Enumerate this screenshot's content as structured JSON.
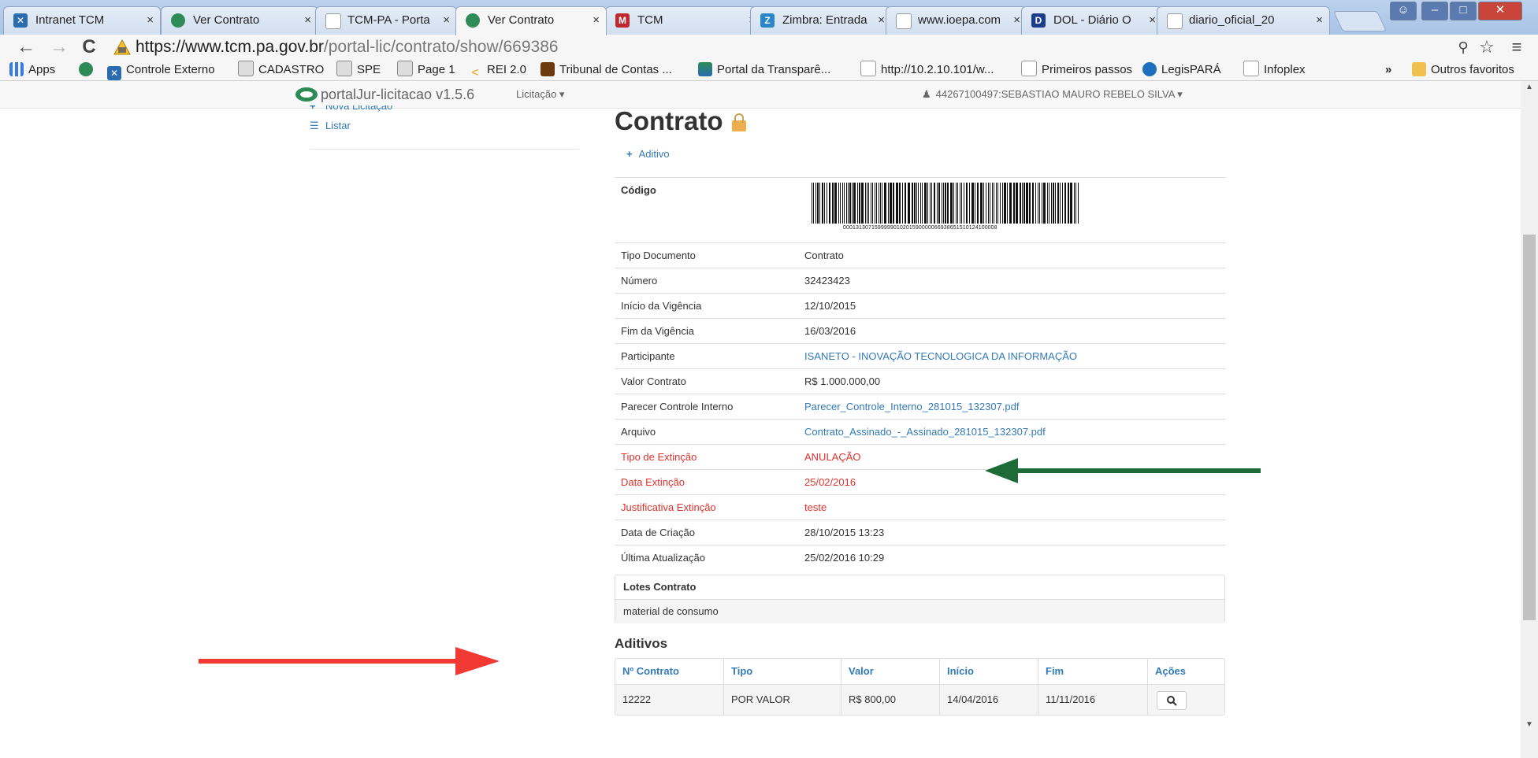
{
  "browser": {
    "tabs": [
      {
        "title": "Intranet TCM",
        "icon": "intranet-icon"
      },
      {
        "title": "Ver Contrato",
        "icon": "tcm-logo-icon"
      },
      {
        "title": "TCM-PA - Porta",
        "icon": "page-icon"
      },
      {
        "title": "Ver Contrato",
        "icon": "tcm-logo-icon"
      },
      {
        "title": "TCM",
        "icon": "tcm-icon"
      },
      {
        "title": "Zimbra: Entrada",
        "icon": "zimbra-icon"
      },
      {
        "title": "www.ioepa.com",
        "icon": "page-icon"
      },
      {
        "title": "DOL - Diário O",
        "icon": "dol-icon"
      },
      {
        "title": "diario_oficial_20",
        "icon": "page-icon"
      }
    ],
    "tab_close": "×",
    "url_host": "https://www.tcm.pa.gov.br",
    "url_path": "/portal-lic/contrato/show/669386",
    "bookmarks": [
      {
        "label": "Apps",
        "icon": "apps-icon"
      },
      {
        "label": "",
        "icon": "tcm-logo-icon"
      },
      {
        "label": "Controle Externo",
        "icon": "intranet-icon"
      },
      {
        "label": "CADASTRO",
        "icon": "image-icon"
      },
      {
        "label": "SPE",
        "icon": "image-icon"
      },
      {
        "label": "Page 1",
        "icon": "image-icon"
      },
      {
        "label": "REI 2.0",
        "icon": "rei-icon"
      },
      {
        "label": "Tribunal de Contas ...",
        "icon": "tribunal-icon"
      },
      {
        "label": "Portal da Transparê...",
        "icon": "flag-icon"
      },
      {
        "label": "http://10.2.10.101/w...",
        "icon": "page-icon"
      },
      {
        "label": "Primeiros passos",
        "icon": "page-icon"
      },
      {
        "label": "LegisPARÁ",
        "icon": "legis-icon"
      },
      {
        "label": "Infoplex",
        "icon": "page-icon"
      }
    ],
    "bookmarks_overflow": "»",
    "other_bookmarks": "Outros favoritos"
  },
  "app": {
    "brand": "portalJur-licitacao",
    "version": "v1.5.6",
    "menu_label": "Licitação ▾",
    "user_label": "44267100497:SEBASTIAO MAURO REBELO SILVA ▾"
  },
  "sidebar": {
    "items": [
      {
        "label": "Nova Licitação",
        "icon": "plus-icon"
      },
      {
        "label": "Listar",
        "icon": "list-icon"
      }
    ]
  },
  "page": {
    "title": "Contrato",
    "add_link": "Aditivo",
    "code_label": "Código",
    "barcode_number": "0001313071599999010201590000066938651510124100008",
    "rows": [
      {
        "key": "Tipo Documento",
        "value": "Contrato"
      },
      {
        "key": "Número",
        "value": "32423423"
      },
      {
        "key": "Início da Vigência",
        "value": "12/10/2015"
      },
      {
        "key": "Fim da Vigência",
        "value": "16/03/2016"
      },
      {
        "key": "Participante",
        "value": "ISANETO - INOVAÇÃO TECNOLOGICA DA INFORMAÇÃO"
      },
      {
        "key": "Valor Contrato",
        "value": "R$ 1.000.000,00"
      },
      {
        "key": "Parecer Controle Interno",
        "value": "Parecer_Controle_Interno_281015_132307.pdf"
      },
      {
        "key": "Arquivo",
        "value": "Contrato_Assinado_-_Assinado_281015_132307.pdf"
      },
      {
        "key": "Tipo de Extinção",
        "value": "ANULAÇÃO"
      },
      {
        "key": "Data Extinção",
        "value": "25/02/2016"
      },
      {
        "key": "Justificativa Extinção",
        "value": "teste"
      },
      {
        "key": "Data de Criação",
        "value": "28/10/2015 13:23"
      },
      {
        "key": "Última Atualização",
        "value": "25/02/2016 10:29"
      }
    ],
    "lotes": {
      "heading": "Lotes Contrato",
      "item": "material de consumo"
    },
    "aditivos": {
      "heading": "Aditivos",
      "columns": [
        "Nº Contrato",
        "Tipo",
        "Valor",
        "Início",
        "Fim",
        "Ações"
      ],
      "rows": [
        {
          "numero": "12222",
          "tipo": "POR VALOR",
          "valor": "R$ 800,00",
          "inicio": "14/04/2016",
          "fim": "11/11/2016"
        }
      ],
      "view_icon": "zoom-icon"
    }
  },
  "annotations": {
    "green_arrow_color": "#1e6b38",
    "red_arrow_color": "#f03a33"
  }
}
